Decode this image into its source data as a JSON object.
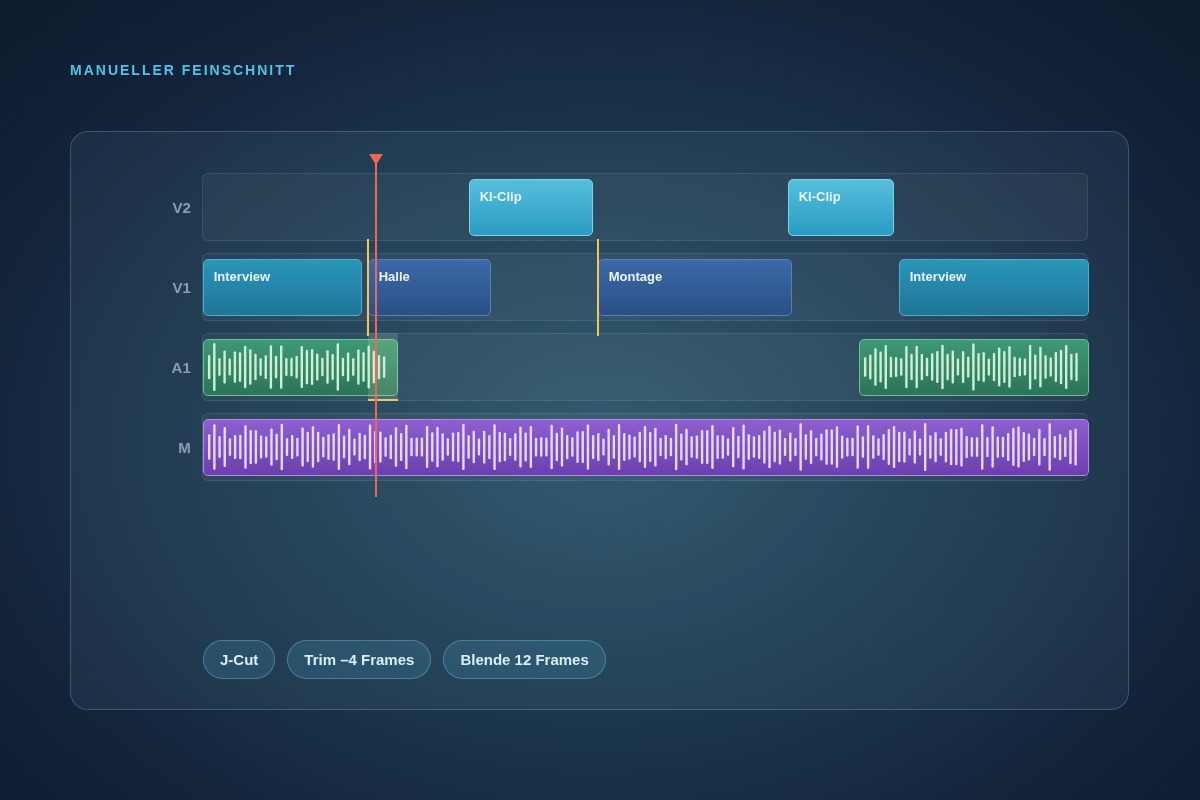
{
  "title": "MANUELLER FEINSCHNITT",
  "tracks": [
    {
      "label": "V2",
      "clips": [
        {
          "kind": "ki",
          "label": "KI-Clip"
        },
        {
          "kind": "ki",
          "label": "KI-Clip"
        }
      ]
    },
    {
      "label": "V1",
      "clips": [
        {
          "kind": "interview",
          "label": "Interview"
        },
        {
          "kind": "broll",
          "label": "Halle"
        },
        {
          "kind": "broll",
          "label": "Montage"
        },
        {
          "kind": "interview",
          "label": "Interview"
        }
      ]
    },
    {
      "label": "A1",
      "clips": [
        {
          "kind": "audio"
        },
        {
          "kind": "audio"
        }
      ]
    },
    {
      "label": "M",
      "clips": [
        {
          "kind": "music"
        }
      ]
    }
  ],
  "chips": [
    "J-Cut",
    "Trim –4 Frames",
    "Blende 12 Frames"
  ]
}
